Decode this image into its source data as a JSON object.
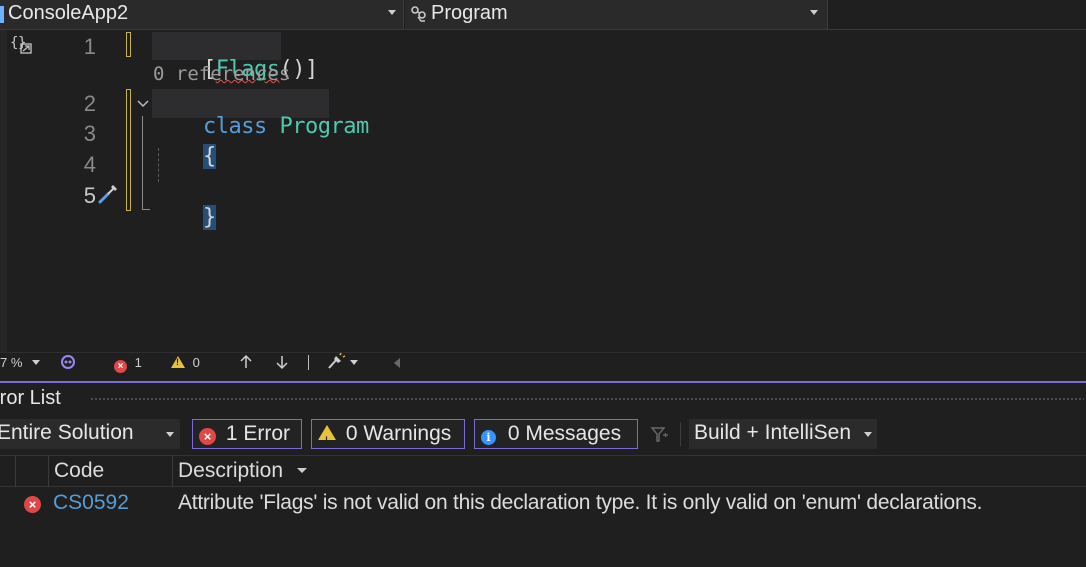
{
  "navbar": {
    "project_combo": {
      "label": "ConsoleApp2"
    },
    "type_combo": {
      "label": "Program",
      "icon": "class-icon"
    }
  },
  "editor": {
    "lines": [
      {
        "number": "1",
        "tokens": [
          "[",
          "Flags",
          "()]"
        ]
      },
      {
        "codelens": "0 references"
      },
      {
        "number": "2",
        "tokens": [
          "class",
          " ",
          "Program"
        ]
      },
      {
        "number": "3",
        "tokens": [
          "{"
        ]
      },
      {
        "number": "4",
        "tokens": []
      },
      {
        "number": "5",
        "tokens": [
          "}"
        ]
      }
    ]
  },
  "editor_status": {
    "zoom": "7 %",
    "errors": "1",
    "warnings": "0"
  },
  "error_list": {
    "title": "rror List",
    "scope": "Entire Solution",
    "errors_btn": "1 Error",
    "warnings_btn": "0 Warnings",
    "messages_btn": "0 Messages",
    "source": "Build + IntelliSen",
    "columns": {
      "code": "Code",
      "description": "Description"
    },
    "rows": [
      {
        "code": "CS0592",
        "description": "Attribute 'Flags' is not valid on this declaration type. It is only valid on 'enum' declarations."
      }
    ]
  },
  "colors": {
    "accent": "#7a6cd6",
    "error": "#e04848",
    "warning": "#e8c23a",
    "info": "#3794ff",
    "keyword": "#569cd6",
    "type": "#4ec9b0"
  }
}
